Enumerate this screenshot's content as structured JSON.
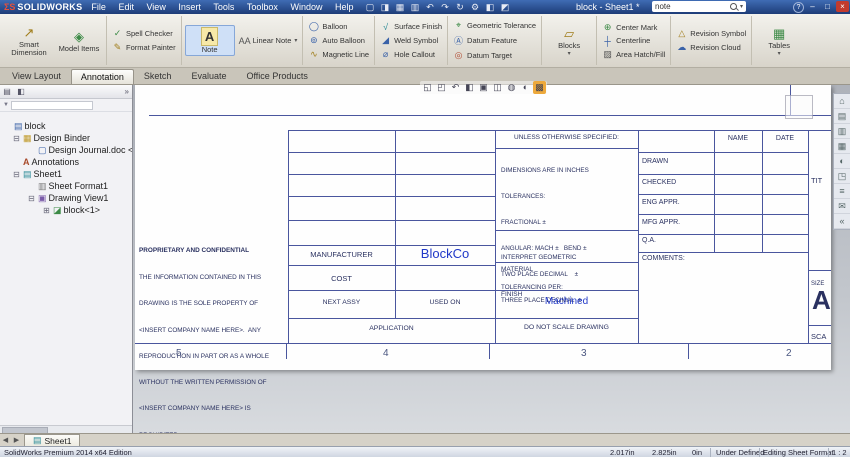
{
  "colors": {
    "note_blue": "#2038c8",
    "format_line_blue": "#4a569e"
  },
  "titlebar": {
    "logo_mark": "ΣS",
    "logo_text": "SOLIDWORKS",
    "menus": [
      "File",
      "Edit",
      "View",
      "Insert",
      "Tools",
      "Toolbox",
      "Window",
      "Help"
    ],
    "quick_icons": [
      {
        "name": "new-document-icon",
        "glyph": "▢"
      },
      {
        "name": "open-icon",
        "glyph": "◨"
      },
      {
        "name": "save-icon",
        "glyph": "▦"
      },
      {
        "name": "print-icon",
        "glyph": "▥"
      },
      {
        "name": "undo-icon",
        "glyph": "↶"
      },
      {
        "name": "redo-icon",
        "glyph": "↷"
      },
      {
        "name": "rebuild-icon",
        "glyph": "↻"
      },
      {
        "name": "options-icon",
        "glyph": "⚙"
      },
      {
        "name": "edit-sheet-icon",
        "glyph": "◧"
      },
      {
        "name": "selection-filter-icon",
        "glyph": "◩"
      }
    ],
    "doc_title": "block - Sheet1 *",
    "search_value": "note",
    "search_caret": "▾",
    "help_glyph": "?",
    "win_minimize": "–",
    "win_maximize": "□",
    "win_close": "×"
  },
  "ribbon": {
    "items": [
      {
        "label": "Smart Dimension",
        "glyph": "↗"
      },
      {
        "label": "Model Items",
        "glyph": "◈"
      },
      {
        "label": "Spell Checker",
        "glyph": "✓"
      },
      {
        "label": "Format Painter",
        "glyph": "✎"
      },
      {
        "label": "Note",
        "glyph": "A"
      },
      {
        "label": "Linear Note",
        "glyph": "AA",
        "caret": "▾"
      },
      {
        "label": "Balloon",
        "glyph": "◯"
      },
      {
        "label": "Auto Balloon",
        "glyph": "⊚"
      },
      {
        "label": "Magnetic Line",
        "glyph": "∿"
      },
      {
        "label": "Surface Finish",
        "glyph": "√"
      },
      {
        "label": "Weld Symbol",
        "glyph": "◢"
      },
      {
        "label": "Hole Callout",
        "glyph": "⌀"
      },
      {
        "label": "Geometric Tolerance",
        "glyph": "⌖"
      },
      {
        "label": "Datum Feature",
        "glyph": "Ⓐ"
      },
      {
        "label": "Datum Target",
        "glyph": "◎"
      },
      {
        "label": "Blocks",
        "glyph": "▱",
        "caret": "▾"
      },
      {
        "label": "Center Mark",
        "glyph": "⊕"
      },
      {
        "label": "Centerline",
        "glyph": "┼"
      },
      {
        "label": "Area Hatch/Fill",
        "glyph": "▨"
      },
      {
        "label": "Revision Symbol",
        "glyph": "△"
      },
      {
        "label": "Revision Cloud",
        "glyph": "☁"
      },
      {
        "label": "Tables",
        "glyph": "▦",
        "caret": "▾"
      }
    ]
  },
  "tabs": [
    "View Layout",
    "Annotation",
    "Sketch",
    "Evaluate",
    "Office Products"
  ],
  "panel": {
    "tab_icons": [
      {
        "name": "feature-tree-tab-icon",
        "glyph": "▤"
      },
      {
        "name": "property-manager-tab-icon",
        "glyph": "◧"
      }
    ],
    "overflow_glyph": "»",
    "filter_glyph": "▼",
    "tree_items": [
      {
        "label": "block",
        "glyph": "▤"
      },
      {
        "label": "Design Binder",
        "glyph": "▦",
        "expander": "⊟"
      },
      {
        "label": "Design Journal.doc <Emp",
        "glyph": "▢"
      },
      {
        "label": "Annotations",
        "glyph": "A"
      },
      {
        "label": "Sheet1",
        "glyph": "▤",
        "expander": "⊟"
      },
      {
        "label": "Sheet Format1",
        "glyph": "▥"
      },
      {
        "label": "Drawing View1",
        "glyph": "▣",
        "expander": "⊟"
      },
      {
        "label": "block<1>",
        "glyph": "◪",
        "expander": "⊞"
      }
    ]
  },
  "viewbar": {
    "icons": [
      {
        "name": "zoom-fit-icon",
        "glyph": "◱"
      },
      {
        "name": "zoom-area-icon",
        "glyph": "◰"
      },
      {
        "name": "previous-view-icon",
        "glyph": "↶"
      },
      {
        "name": "section-view-icon",
        "glyph": "◧"
      },
      {
        "name": "view-orientation-icon",
        "glyph": "▣"
      },
      {
        "name": "display-style-icon",
        "glyph": "◫"
      },
      {
        "name": "hide-show-items-icon",
        "glyph": "◍"
      },
      {
        "name": "edit-appearance-icon",
        "glyph": "◐"
      },
      {
        "name": "apply-scene-icon",
        "glyph": "▩"
      }
    ]
  },
  "taskpane": {
    "icons": [
      {
        "name": "resources-icon",
        "glyph": "⌂"
      },
      {
        "name": "design-library-icon",
        "glyph": "▤"
      },
      {
        "name": "file-explorer-icon",
        "glyph": "▥"
      },
      {
        "name": "view-palette-icon",
        "glyph": "▦"
      },
      {
        "name": "appearances-icon",
        "glyph": "◐"
      },
      {
        "name": "scene-icon",
        "glyph": "◳"
      },
      {
        "name": "custom-properties-icon",
        "glyph": "≡"
      },
      {
        "name": "forum-icon",
        "glyph": "✉"
      },
      {
        "name": "collapse-icon",
        "glyph": "«"
      }
    ]
  },
  "sheet": {
    "unless": "UNLESS OTHERWISE SPECIFIED:",
    "tol_lines": [
      "DIMENSIONS ARE IN INCHES",
      "TOLERANCES:",
      "FRACTIONAL ±",
      "ANGULAR: MACH ±   BEND ±",
      "TWO PLACE DECIMAL    ±",
      "THREE PLACE DECIMAL  ±"
    ],
    "interpret_1": "INTERPRET GEOMETRIC",
    "interpret_2": "TOLERANCING PER:",
    "material": "MATERIAL",
    "finish": "FINISH",
    "finish_value": "Machined",
    "do_not_scale": "DO NOT SCALE DRAWING",
    "manufacturer": "MANUFACTURER",
    "manufacturer_value": "BlockCo",
    "cost": "COST",
    "next_assy": "NEXT ASSY",
    "used_on": "USED ON",
    "application": "APPLICATION",
    "name_header": "NAME",
    "date_header": "DATE",
    "rows": [
      "DRAWN",
      "CHECKED",
      "ENG APPR.",
      "MFG APPR.",
      "Q.A."
    ],
    "comments": "COMMENTS:",
    "title_cut": "TIT",
    "size": "SIZE",
    "size_value": "A",
    "scale_cut": "SCA",
    "prop_title": "PROPRIETARY AND CONFIDENTIAL",
    "prop_lines": [
      "THE INFORMATION CONTAINED IN THIS",
      "DRAWING IS THE SOLE PROPERTY OF",
      "<INSERT COMPANY NAME HERE>.  ANY",
      "REPRODUCTION IN PART OR AS A WHOLE",
      "WITHOUT THE WRITTEN PERMISSION OF",
      "<INSERT COMPANY NAME HERE> IS",
      "PROHIBITED."
    ],
    "zones": [
      "5",
      "4",
      "3",
      "2"
    ]
  },
  "sheettabs": {
    "nav_prev": "◀",
    "nav_next": "▶",
    "tab_label": "Sheet1",
    "tab_glyph": "▤"
  },
  "statusbar": {
    "edition": "SolidWorks Premium 2014 x64 Edition",
    "x": "2.017in",
    "y": "2.825in",
    "z": "0in",
    "state": "Under Defined",
    "mode": "Editing Sheet Format",
    "scale": "1 : 2"
  }
}
